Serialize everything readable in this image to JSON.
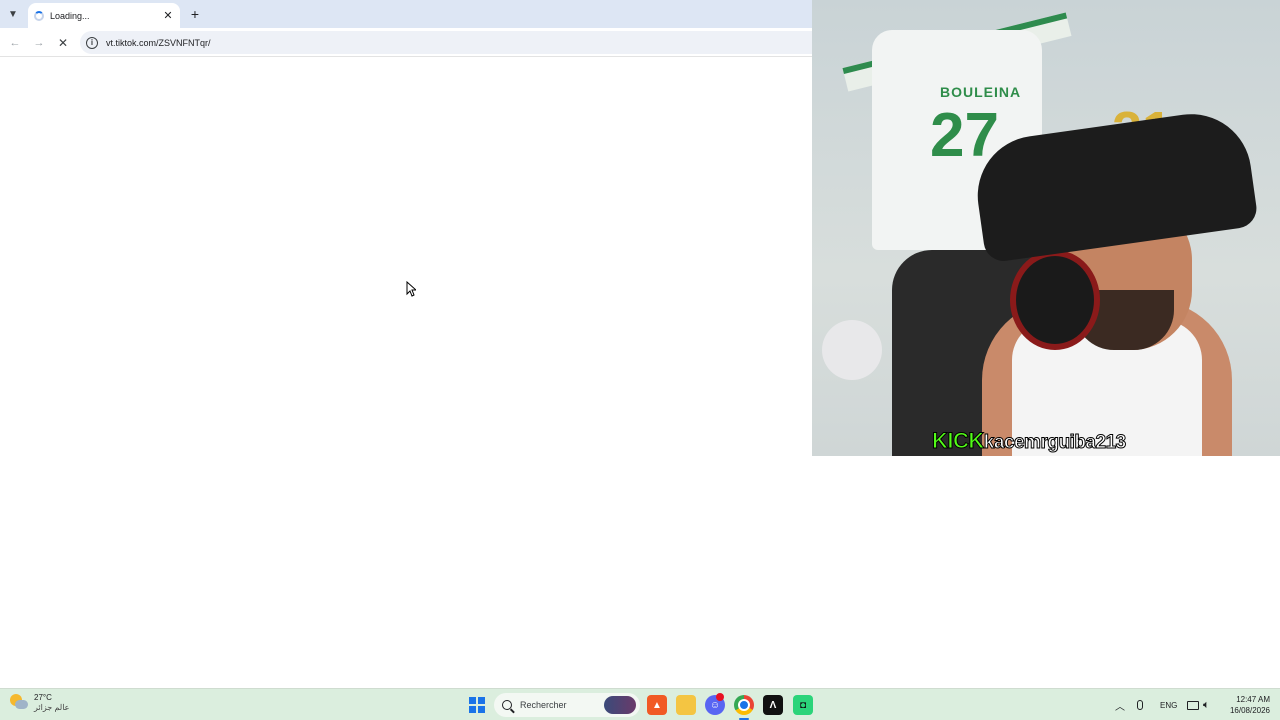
{
  "browser": {
    "tab": {
      "title": "Loading..."
    },
    "address": {
      "url": "vt.tiktok.com/ZSVNFNTqr/"
    }
  },
  "webcam": {
    "jersey_name": "BOULEINA",
    "jersey_number": "27",
    "caption_brand": "KICK",
    "caption_handle": "kacemrguiba213",
    "colors": {
      "kick_green": "#53fc18"
    }
  },
  "taskbar": {
    "weather": {
      "temp": "27°C",
      "desc": "عالم جزائر",
      "icon": "partly-cloudy-icon"
    },
    "search": {
      "label": "Rechercher"
    },
    "apps": [
      "brave-icon",
      "file-explorer-icon",
      "discord-icon",
      "chrome-icon",
      "lambda-app-icon",
      "green-app-icon"
    ],
    "tray": {
      "language": "ENG"
    },
    "clock": {
      "time": "12:47 AM",
      "date": "16/08/2026"
    },
    "colors": {
      "background": "#dbeede",
      "accent": "#1a73e8"
    }
  }
}
